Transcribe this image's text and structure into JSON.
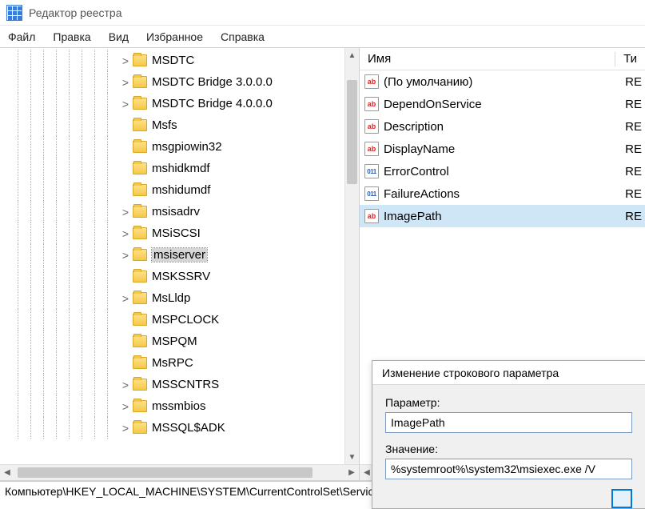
{
  "app": {
    "title": "Редактор реестра"
  },
  "menu": {
    "file": "Файл",
    "edit": "Правка",
    "view": "Вид",
    "favorites": "Избранное",
    "help": "Справка"
  },
  "tree": {
    "items": [
      {
        "label": "MSDTC",
        "exp": ">"
      },
      {
        "label": "MSDTC Bridge 3.0.0.0",
        "exp": ">"
      },
      {
        "label": "MSDTC Bridge 4.0.0.0",
        "exp": ">"
      },
      {
        "label": "Msfs",
        "exp": ""
      },
      {
        "label": "msgpiowin32",
        "exp": ""
      },
      {
        "label": "mshidkmdf",
        "exp": ""
      },
      {
        "label": "mshidumdf",
        "exp": ""
      },
      {
        "label": "msisadrv",
        "exp": ">"
      },
      {
        "label": "MSiSCSI",
        "exp": ">"
      },
      {
        "label": "msiserver",
        "exp": ">",
        "selected": true
      },
      {
        "label": "MSKSSRV",
        "exp": ""
      },
      {
        "label": "MsLldp",
        "exp": ">"
      },
      {
        "label": "MSPCLOCK",
        "exp": ""
      },
      {
        "label": "MSPQM",
        "exp": ""
      },
      {
        "label": "MsRPC",
        "exp": ""
      },
      {
        "label": "MSSCNTRS",
        "exp": ">"
      },
      {
        "label": "mssmbios",
        "exp": ">"
      },
      {
        "label": "MSSQL$ADK",
        "exp": ">"
      }
    ]
  },
  "list": {
    "col_name": "Имя",
    "col_type": "Ти",
    "type_sz": "RE",
    "rows": [
      {
        "icon": "ab",
        "name": "(По умолчанию)"
      },
      {
        "icon": "ab",
        "name": "DependOnService"
      },
      {
        "icon": "ab",
        "name": "Description"
      },
      {
        "icon": "ab",
        "name": "DisplayName"
      },
      {
        "icon": "bin",
        "name": "ErrorControl"
      },
      {
        "icon": "bin",
        "name": "FailureActions"
      },
      {
        "icon": "ab",
        "name": "ImagePath",
        "selected": true
      }
    ]
  },
  "dialog": {
    "title": "Изменение строкового параметра",
    "param_label": "Параметр:",
    "param_value": "ImagePath",
    "value_label": "Значение:",
    "value_value": "%systemroot%\\system32\\msiexec.exe /V"
  },
  "statusbar": "Компьютер\\HKEY_LOCAL_MACHINE\\SYSTEM\\CurrentControlSet\\Services\\msiserver"
}
